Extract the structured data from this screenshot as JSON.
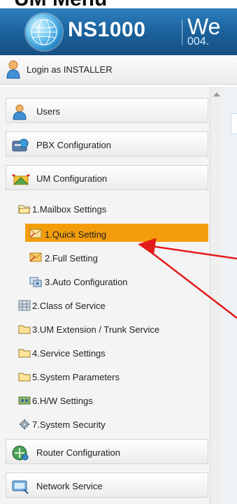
{
  "caption": {
    "text": "UM Menu"
  },
  "header": {
    "brand": "NS1000",
    "welcome": "We",
    "subtitle": "004."
  },
  "login": {
    "label": "Login as INSTALLER"
  },
  "sections": [
    {
      "label": "Users",
      "icon": "users-icon"
    },
    {
      "label": "PBX Configuration",
      "icon": "pbx-icon"
    },
    {
      "label": "UM Configuration",
      "icon": "um-config-icon"
    }
  ],
  "menu": {
    "mailbox_settings": "1.Mailbox Settings",
    "quick_setting": "1.Quick Setting",
    "full_setting": "2.Full Setting",
    "auto_configuration": "3.Auto Configuration",
    "class_of_service": "2.Class of Service",
    "um_extension": "3.UM Extension / Trunk Service",
    "service_settings": "4.Service Settings",
    "system_parameters": "5.System Parameters",
    "hw_settings": "6.H/W Settings",
    "system_security": "7.System Security"
  },
  "bottom_sections": [
    {
      "label": "Router Configuration",
      "icon": "router-icon"
    },
    {
      "label": "Network Service",
      "icon": "network-service-icon"
    }
  ],
  "colors": {
    "header": "#1a5f99",
    "selected": "#f49d0c",
    "pointer_arrow": "#e31b1b"
  }
}
